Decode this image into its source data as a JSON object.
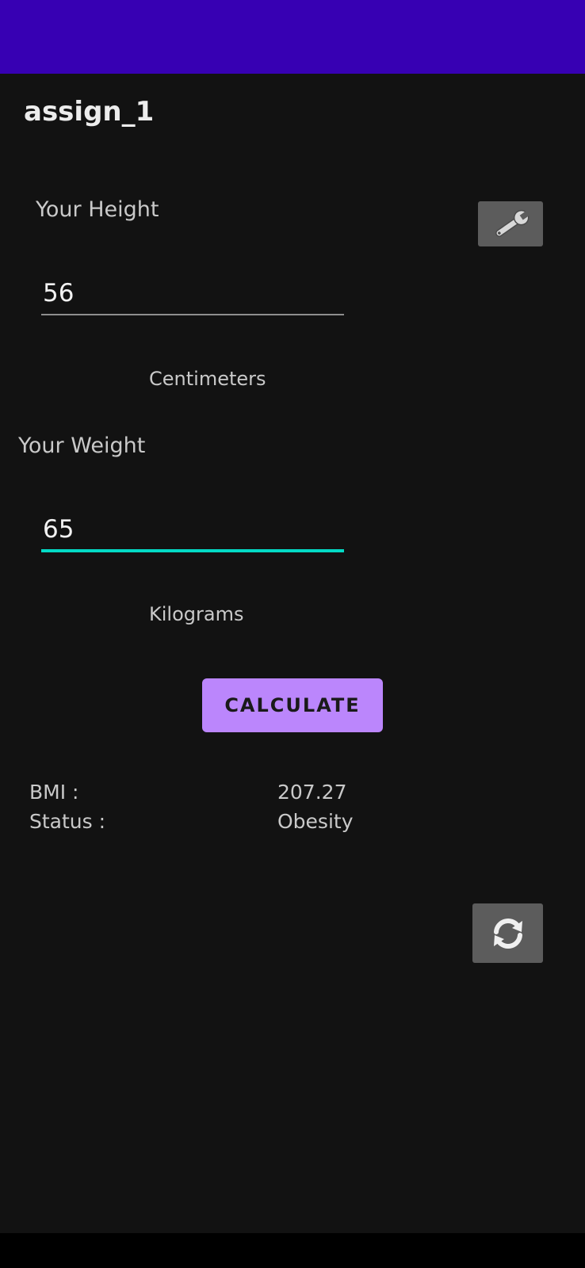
{
  "app": {
    "title": "assign_1"
  },
  "height": {
    "label": "Your Height",
    "value": "56",
    "unit": "Centimeters"
  },
  "weight": {
    "label": "Your Weight",
    "value": "65",
    "unit": "Kilograms"
  },
  "actions": {
    "calculate_label": "CALCULATE",
    "settings_icon": "wrench-icon",
    "reset_icon": "refresh-icon"
  },
  "results": {
    "bmi_label": "BMI :",
    "bmi_value": "207.27",
    "status_label": "Status :",
    "status_value": "Obesity"
  },
  "colors": {
    "status_bar": "#3700B3",
    "background": "#121212",
    "accent_button": "#BB86FC",
    "focused_underline": "#03DAC5",
    "icon_button": "#5C5C5C"
  }
}
